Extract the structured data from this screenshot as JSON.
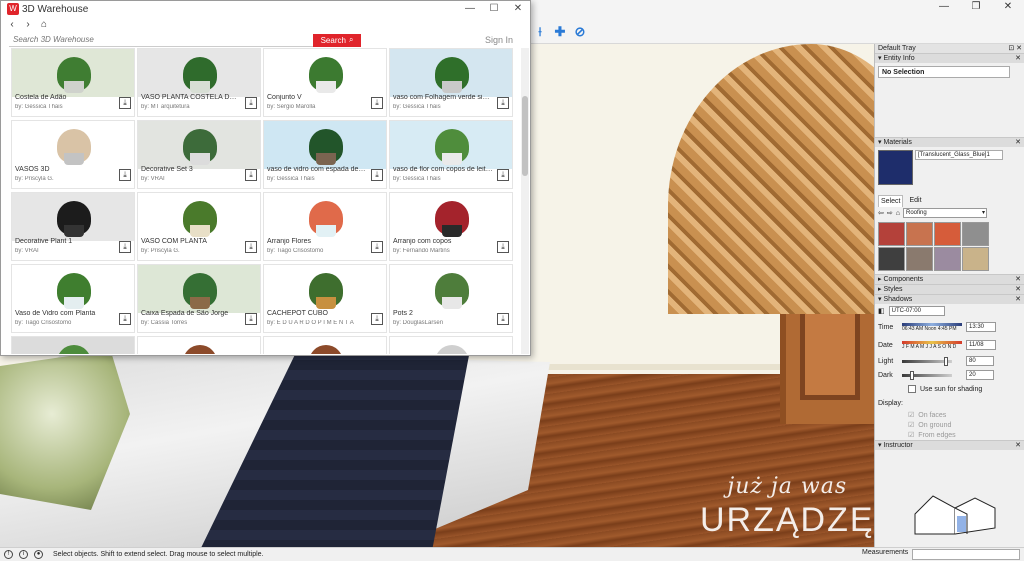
{
  "app": {
    "window_controls": {
      "minimize": "—",
      "maximize": "❐",
      "close": "✕"
    },
    "toolbar": [
      {
        "icon": "section-icon",
        "glyph": "⟊"
      },
      {
        "icon": "add-icon",
        "glyph": "✚"
      },
      {
        "icon": "tag-icon",
        "glyph": "⊘"
      }
    ]
  },
  "warehouse": {
    "title": "3D Warehouse",
    "logo_glyph": "W",
    "win_buttons": {
      "minimize": "—",
      "maximize": "☐",
      "close": "✕"
    },
    "nav": {
      "back": "‹",
      "forward": "›",
      "home": "⌂"
    },
    "search_placeholder": "Search 3D Warehouse",
    "search_label": "Search",
    "signin": "Sign In",
    "download_glyph": "⤓",
    "items": [
      {
        "title": "Costela de Adão",
        "by": "by: Gessica Thais",
        "bg": "#dfe7d6",
        "plant": "#3f7d32",
        "pot": "#cfd2cc"
      },
      {
        "title": "VASO PLANTA COSTELA DE ADÃO",
        "by": "by: MT arquitetura",
        "bg": "#e6e6e6",
        "plant": "#2f6b2c",
        "pot": "#d8dfd5"
      },
      {
        "title": "Conjunto V",
        "by": "by: Sergio Marolla",
        "bg": "#ffffff",
        "plant": "#3c7a30",
        "pot": "#e9e9e9"
      },
      {
        "title": "vaso com Folhagem verde simples",
        "by": "by: Gessica Thais",
        "bg": "#d4e6f0",
        "plant": "#2f6f2a",
        "pot": "#c9c9c9"
      },
      {
        "title": "VASOS 3D",
        "by": "by: Priscyla G.",
        "bg": "#ffffff",
        "plant": "#d9c3a6",
        "pot": "#c3c3c3"
      },
      {
        "title": "Decorative Set 3",
        "by": "by: VRAI",
        "bg": "#e2e4e0",
        "plant": "#3d6b3a",
        "pot": "#dcdcdc"
      },
      {
        "title": "vaso de vidro com espada de são jorge",
        "by": "by: Gessica Thais",
        "bg": "#cfe7f3",
        "plant": "#22552a",
        "pot": "#7a6450"
      },
      {
        "title": "vaso de flor com copos de leite brancos",
        "by": "by: Gessica Thais",
        "bg": "#d7ebf4",
        "plant": "#4f8d3c",
        "pot": "#eaeaea"
      },
      {
        "title": "Decorative Plant 1",
        "by": "by: VRAI",
        "bg": "#e6e6e6",
        "plant": "#1c1c1c",
        "pot": "#333333"
      },
      {
        "title": "VASO COM PLANTA",
        "by": "by: Priscyla G.",
        "bg": "#ffffff",
        "plant": "#4a7a2b",
        "pot": "#e8dfc7"
      },
      {
        "title": "Arranjo Flores",
        "by": "by: Tiago Crisostomo",
        "bg": "#ffffff",
        "plant": "#e06a4a",
        "pot": "#e2f1f5"
      },
      {
        "title": "Arranjo com copos",
        "by": "by: Fernando Martins",
        "bg": "#ffffff",
        "plant": "#a4232c",
        "pot": "#2a2a2a"
      },
      {
        "title": "Vaso de Vidro com Planta",
        "by": "by: Tiago Crisostomo",
        "bg": "#ffffff",
        "plant": "#3f7e2f",
        "pot": "#e4eef0"
      },
      {
        "title": "Caixa Espada de São Jorge",
        "by": "by: Cassia Torres",
        "bg": "#dde7d6",
        "plant": "#356f34",
        "pot": "#8b6a47"
      },
      {
        "title": "CACHEPOT CUBO",
        "by": "by: E D U A R D O P I M E N T A",
        "bg": "#ffffff",
        "plant": "#3e6e2e",
        "pot": "#c7903f"
      },
      {
        "title": "Pots 2",
        "by": "by: DouglasLarsen",
        "bg": "#ffffff",
        "plant": "#4e7d3b",
        "pot": "#e7e7e7"
      },
      {
        "title": "",
        "by": "",
        "bg": "#dcdcdc",
        "plant": "#4d8c3c",
        "pot": "#3d6fb6"
      },
      {
        "title": "",
        "by": "",
        "bg": "#ffffff",
        "plant": "#8c4a2a",
        "pot": "#8c4a2a"
      },
      {
        "title": "",
        "by": "",
        "bg": "#ffffff",
        "plant": "#8c4a2a",
        "pot": "#8c4a2a"
      },
      {
        "title": "",
        "by": "",
        "bg": "#ffffff",
        "plant": "#cfcfcf",
        "pot": "#dcdcdc"
      }
    ]
  },
  "tray": {
    "title": "Default Tray",
    "pin": "⊡ ✕",
    "entity_info": {
      "label": "Entity Info",
      "value": "No Selection"
    },
    "materials": {
      "label": "Materials",
      "current": "[Translucent_Glass_Blue]1",
      "swatch_color": "#1e2d6b",
      "tab_select": "Select",
      "tab_edit": "Edit",
      "category": "Roofing",
      "swatches": [
        "#b4413a",
        "#c8734f",
        "#d65c3a",
        "#8f8f8f",
        "#3f3f3f",
        "#8a7a6e",
        "#9b8ba0",
        "#c9b38a"
      ]
    },
    "components": {
      "label": "Components"
    },
    "styles": {
      "label": "Styles"
    },
    "shadows": {
      "label": "Shadows",
      "timezone": "UTC-07:00",
      "time_label": "Time",
      "time_ticks": "06:43 AM  Noon  4:45 PM",
      "time_value": "13:30",
      "date_label": "Date",
      "date_ticks": "J F M A M J J A S O N D",
      "date_value": "11/08",
      "light_label": "Light",
      "light_value": "80",
      "dark_label": "Dark",
      "dark_value": "20",
      "sun_label": "Use sun for shading",
      "display_label": "Display:",
      "on_faces": "On faces",
      "on_ground": "On ground",
      "from_edges": "From edges"
    },
    "instructor": {
      "label": "Instructor"
    }
  },
  "scene": {
    "watermark_line1": "już ja was",
    "watermark_line2": "URZĄDZĘ"
  },
  "status": {
    "text": "Select objects. Shift to extend select. Drag mouse to select multiple.",
    "measurements_label": "Measurements"
  }
}
